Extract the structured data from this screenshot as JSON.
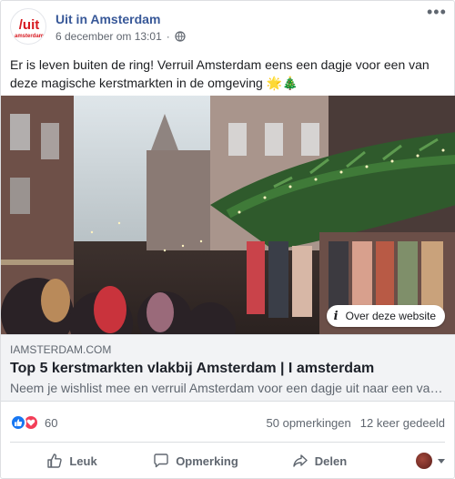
{
  "post": {
    "page_name": "Uit in Amsterdam",
    "avatar_text": "/uit",
    "avatar_subtext": "amsterdam",
    "timestamp": "6 december om 13:01",
    "separator": "·",
    "body_text": "Er is leven buiten de ring! Verruil Amsterdam eens een dagje voor een van deze magische kerstmarkten in de omgeving 🌟🎄"
  },
  "link_preview": {
    "info_label": "Over deze website",
    "domain": "IAMSTERDAM.COM",
    "title": "Top 5 kerstmarkten vlakbij Amsterdam | I amsterdam",
    "description": "Neem je wishlist mee en verruil Amsterdam voor een dagje uit naar een van..."
  },
  "stats": {
    "reaction_count": "60",
    "comments": "50 opmerkingen",
    "shares": "12 keer gedeeld"
  },
  "actions": {
    "like": "Leuk",
    "comment": "Opmerking",
    "share": "Delen"
  },
  "icons": {
    "globe": "globe-icon",
    "more": "more-options-icon",
    "like": "thumbs-up-icon",
    "comment": "comment-bubble-icon",
    "share": "share-arrow-icon",
    "reaction_like": "like-reaction-icon",
    "reaction_love": "love-reaction-icon"
  },
  "colors": {
    "brand_link": "#385898",
    "like_blue": "#1877f2",
    "love_red": "#f33e58",
    "logo_red": "#d71920"
  }
}
